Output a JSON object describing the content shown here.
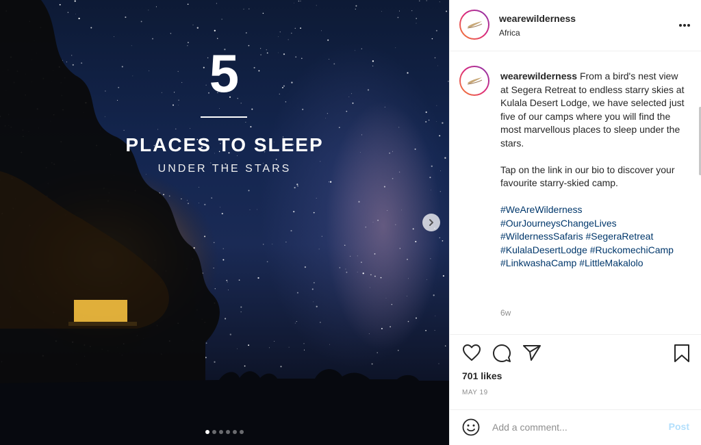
{
  "post_image": {
    "number": "5",
    "headline": "PLACES TO SLEEP",
    "subline": "UNDER THE STARS",
    "slide_count": 6,
    "active_slide": 1
  },
  "header": {
    "username": "wearewilderness",
    "location": "Africa",
    "more_icon": "more-horizontal-icon"
  },
  "caption": {
    "username": "wearewilderness",
    "text": "From a bird's nest view at Segera Retreat to endless starry skies at Kulala Desert Lodge, we have selected just five of our camps where you will find the most marvellous places to sleep under the stars.",
    "text2": "Tap on the link in our bio to discover your favourite starry-skied camp.",
    "hashtags": [
      "#WeAreWilderness",
      "#OurJourneysChangeLives",
      "#WildernessSafaris",
      "#SegeraRetreat",
      "#KulalaDesertLodge",
      "#RuckomechiCamp",
      "#LinkwashaCamp",
      "#LittleMakalolo"
    ],
    "age": "6w"
  },
  "actions": {
    "likes": "701 likes",
    "date": "MAY 19"
  },
  "add_comment": {
    "placeholder": "Add a comment...",
    "post_label": "Post"
  },
  "colors": {
    "hashtag": "#00376b",
    "post_disabled": "#b2dffc",
    "muted": "#8e8e8e"
  }
}
